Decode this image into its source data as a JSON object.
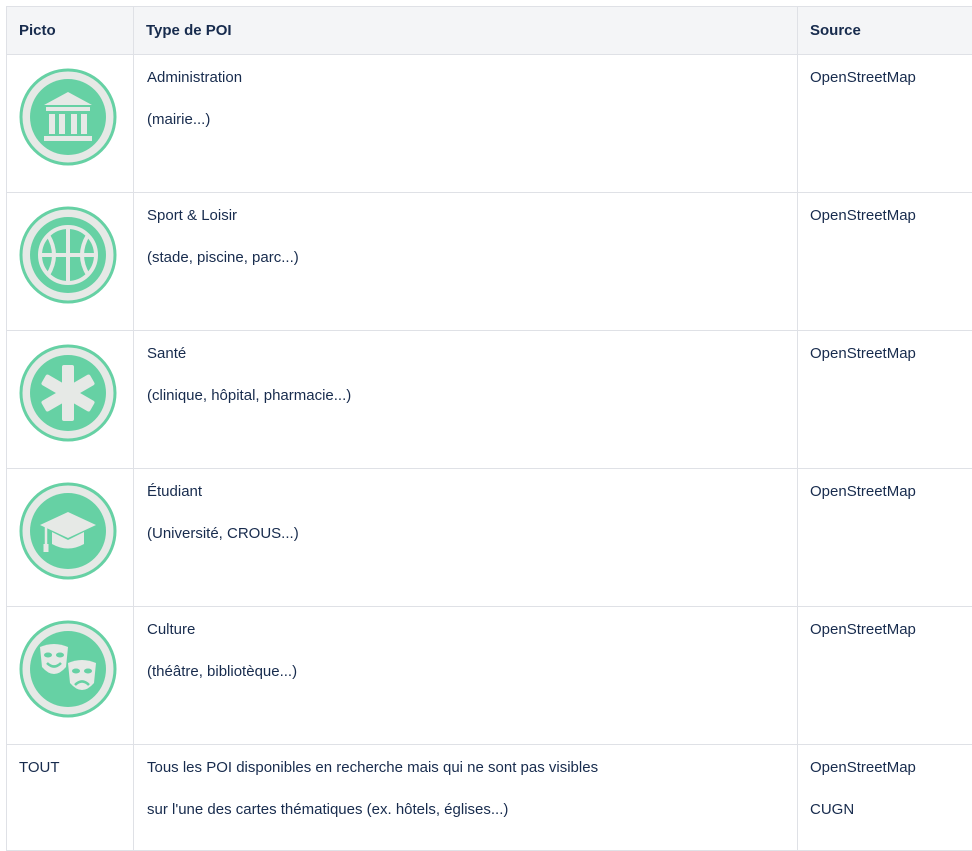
{
  "table": {
    "headers": {
      "picto": "Picto",
      "type": "Type de POI",
      "source": "Source"
    },
    "rows": [
      {
        "icon": "bank-building-icon",
        "title": "Administration",
        "subtitle": "(mairie...)",
        "sources": [
          "OpenStreetMap"
        ]
      },
      {
        "icon": "basketball-icon",
        "title": "Sport & Loisir",
        "subtitle": "(stade, piscine, parc...)",
        "sources": [
          "OpenStreetMap"
        ]
      },
      {
        "icon": "medical-asterisk-icon",
        "title": "Santé",
        "subtitle": "(clinique, hôpital, pharmacie...)",
        "sources": [
          "OpenStreetMap"
        ]
      },
      {
        "icon": "graduation-cap-icon",
        "title": "Étudiant",
        "subtitle": "(Université, CROUS...)",
        "sources": [
          "OpenStreetMap"
        ]
      },
      {
        "icon": "theater-masks-icon",
        "title": "Culture",
        "subtitle": "(théâtre, bibliotèque...)",
        "sources": [
          "OpenStreetMap"
        ]
      },
      {
        "picto_text": "TOUT",
        "title": "Tous les POI disponibles en recherche mais qui ne sont pas visibles",
        "subtitle": "sur l'une des cartes thématiques (ex. hôtels, églises...)",
        "sources": [
          "OpenStreetMap",
          "CUGN"
        ]
      }
    ]
  },
  "colors": {
    "icon_fill": "#66d1a4",
    "icon_ring": "#66d1a4",
    "icon_bg": "#e6e9e6",
    "header_bg": "#f4f5f7",
    "border": "#dfe1e6",
    "text": "#172b4d"
  }
}
